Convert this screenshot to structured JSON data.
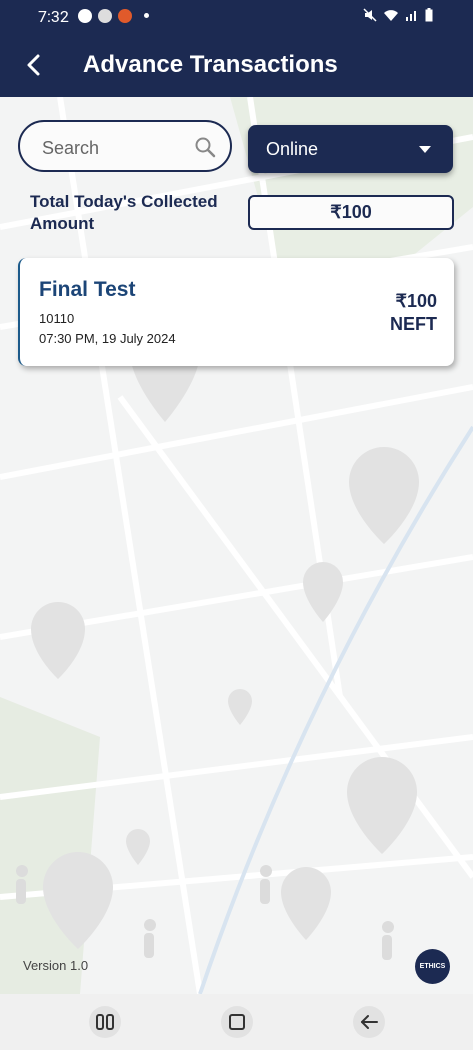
{
  "status_bar": {
    "time": "7:32"
  },
  "header": {
    "title": "Advance Transactions"
  },
  "search": {
    "placeholder": "Search"
  },
  "filter": {
    "selected": "Online"
  },
  "total": {
    "label": "Total Today's Collected Amount",
    "amount": "₹100"
  },
  "transactions": [
    {
      "name": "Final Test",
      "id": "10110",
      "datetime": "07:30 PM, 19 July 2024",
      "amount": "₹100",
      "method": "NEFT"
    }
  ],
  "footer": {
    "version": "Version 1.0",
    "logo_text": "ETHICS"
  },
  "colors": {
    "primary": "#1c2a52",
    "card_title": "#1c4577",
    "background": "#f2f3f3"
  },
  "icons": [
    "back-arrow-icon",
    "search-icon",
    "dropdown-caret-icon",
    "recents-icon",
    "home-icon",
    "system-back-icon"
  ]
}
